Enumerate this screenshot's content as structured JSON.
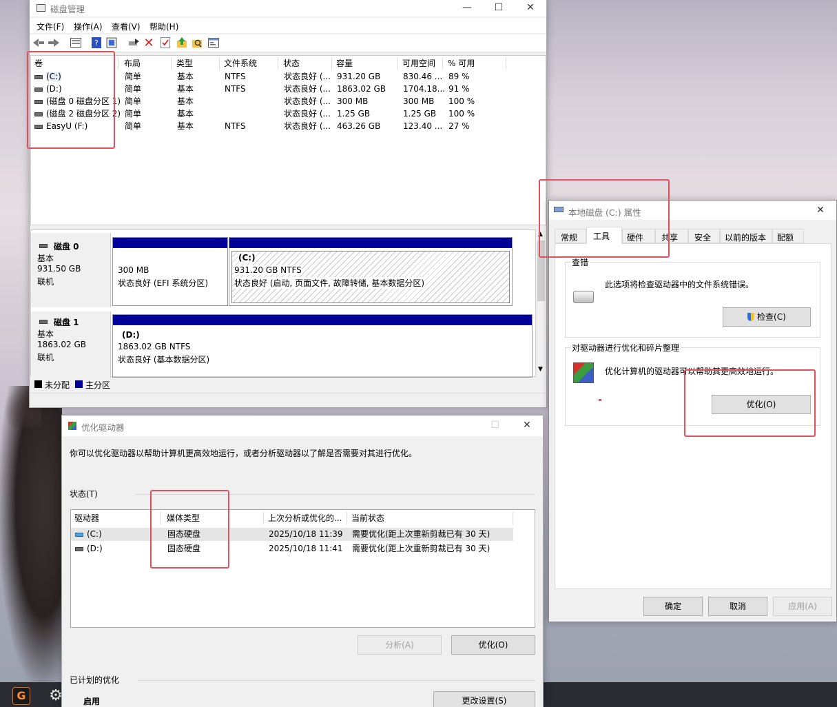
{
  "colors": {
    "primary_partition": "#000099",
    "unallocated": "#000000",
    "highlight": "#e24f5d"
  },
  "diskmgmt": {
    "title": "磁盘管理",
    "menu": [
      "文件(F)",
      "操作(A)",
      "查看(V)",
      "帮助(H)"
    ],
    "toolbar_icons": [
      "back-arrow-icon",
      "forward-arrow-icon",
      "list-view-icon",
      "help-icon",
      "help-book-icon",
      "refresh-icon",
      "delete-x-icon",
      "properties-check-icon",
      "up-folder-icon",
      "search-folder-icon",
      "console-icon"
    ],
    "columns": [
      "卷",
      "布局",
      "类型",
      "文件系统",
      "状态",
      "容量",
      "可用空间",
      "% 可用"
    ],
    "volumes": [
      {
        "name": "(C:)",
        "layout": "简单",
        "type": "基本",
        "fs": "NTFS",
        "status": "状态良好 (...",
        "capacity": "931.20 GB",
        "free": "830.46 ...",
        "pct": "89 %"
      },
      {
        "name": "(D:)",
        "layout": "简单",
        "type": "基本",
        "fs": "NTFS",
        "status": "状态良好 (...",
        "capacity": "1863.02 GB",
        "free": "1704.18...",
        "pct": "91 %"
      },
      {
        "name": "(磁盘 0 磁盘分区 1)",
        "layout": "简单",
        "type": "基本",
        "fs": "",
        "status": "状态良好 (...",
        "capacity": "300 MB",
        "free": "300 MB",
        "pct": "100 %"
      },
      {
        "name": "(磁盘 2 磁盘分区 2)",
        "layout": "简单",
        "type": "基本",
        "fs": "",
        "status": "状态良好 (...",
        "capacity": "1.25 GB",
        "free": "1.25 GB",
        "pct": "100 %"
      },
      {
        "name": "EasyU (F:)",
        "layout": "简单",
        "type": "基本",
        "fs": "NTFS",
        "status": "状态良好 (...",
        "capacity": "463.26 GB",
        "free": "123.40 ...",
        "pct": "27 %"
      }
    ],
    "disk0": {
      "name": "磁盘 0",
      "type": "基本",
      "size": "931.50 GB",
      "state": "联机",
      "p1_size": "300 MB",
      "p1_status": "状态良好 (EFI 系统分区)",
      "p2_name": "(C:)",
      "p2_size": "931.20 GB NTFS",
      "p2_status": "状态良好 (启动, 页面文件, 故障转储, 基本数据分区)"
    },
    "disk1": {
      "name": "磁盘 1",
      "type": "基本",
      "size": "1863.02 GB",
      "state": "联机",
      "p1_name": "(D:)",
      "p1_size": "1863.02 GB NTFS",
      "p1_status": "状态良好 (基本数据分区)"
    },
    "legend": {
      "unallocated": "未分配",
      "primary": "主分区"
    }
  },
  "props": {
    "title": "本地磁盘 (C:) 属性",
    "tabs": [
      "常规",
      "工具",
      "硬件",
      "共享",
      "安全",
      "以前的版本",
      "配额"
    ],
    "check_group": "查错",
    "check_desc": "此选项将检查驱动器中的文件系统错误。",
    "check_btn": "检查(C)",
    "opt_group": "对驱动器进行优化和碎片整理",
    "opt_desc": "优化计算机的驱动器可以帮助其更高效地运行。",
    "opt_btn": "优化(O)",
    "ok": "确定",
    "cancel": "取消",
    "apply": "应用(A)"
  },
  "optimize": {
    "title": "优化驱动器",
    "desc": "你可以优化驱动器以帮助计算机更高效地运行，或者分析驱动器以了解是否需要对其进行优化。",
    "status_label": "状态(T)",
    "columns": [
      "驱动器",
      "媒体类型",
      "上次分析或优化的...",
      "当前状态"
    ],
    "drives": [
      {
        "name": "(C:)",
        "media": "固态硬盘",
        "last": "2025/10/18 11:39",
        "state": "需要优化(距上次重新剪裁已有 30 天)"
      },
      {
        "name": "(D:)",
        "media": "固态硬盘",
        "last": "2025/10/18 11:41",
        "state": "需要优化(距上次重新剪裁已有 30 天)"
      }
    ],
    "analyze_btn": "分析(A)",
    "optimize_btn": "优化(O)",
    "scheduled_label": "已计划的优化",
    "scheduled_state": "启用",
    "change_btn": "更改设置(S)"
  },
  "taskbar": {
    "app_icon": "G",
    "settings_icon": "gear-icon"
  }
}
